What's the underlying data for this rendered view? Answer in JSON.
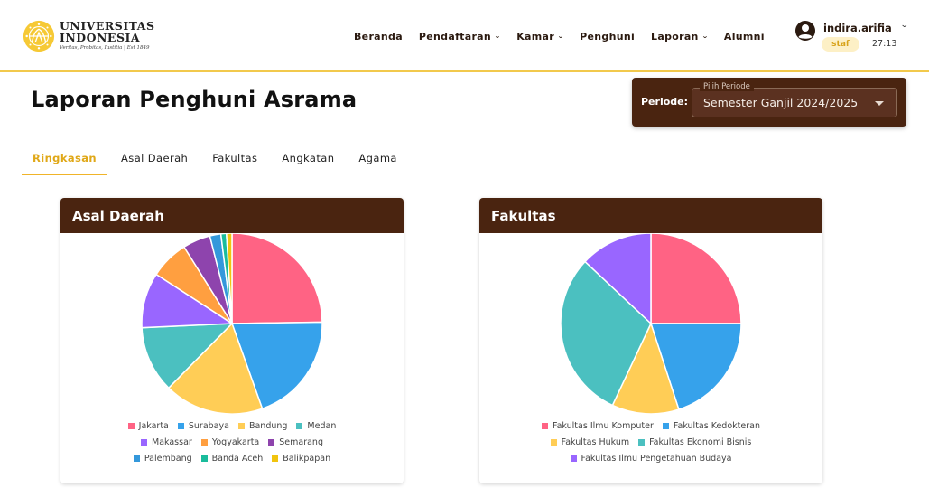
{
  "header": {
    "logo": {
      "line1": "UNIVERSITAS",
      "line2": "INDONESIA",
      "tagline": "Veritas, Probitas, Iustitia | Est 1849"
    },
    "nav": [
      {
        "label": "Beranda",
        "dropdown": false
      },
      {
        "label": "Pendaftaran",
        "dropdown": true
      },
      {
        "label": "Kamar",
        "dropdown": true
      },
      {
        "label": "Penghuni",
        "dropdown": false
      },
      {
        "label": "Laporan",
        "dropdown": true
      },
      {
        "label": "Alumni",
        "dropdown": false
      }
    ],
    "user": {
      "name": "indira.arifia",
      "role": "staf",
      "time": "27:13",
      "icon": "account-circle-icon"
    }
  },
  "page": {
    "title": "Laporan Penghuni Asrama",
    "period": {
      "label": "Periode:",
      "field_label": "Pilih Periode",
      "value": "Semester Ganjil 2024/2025"
    },
    "tabs": [
      "Ringkasan",
      "Asal Daerah",
      "Fakultas",
      "Angkatan",
      "Agama"
    ],
    "active_tab": "Ringkasan"
  },
  "colors": {
    "brown": "#4a2410",
    "accent": "#f2c94c"
  },
  "chart_data": [
    {
      "type": "pie",
      "title": "Asal Daerah",
      "categories": [
        "Jakarta",
        "Surabaya",
        "Bandung",
        "Medan",
        "Makassar",
        "Yogyakarta",
        "Semarang",
        "Palembang",
        "Banda Aceh",
        "Balikpapan"
      ],
      "values": [
        25,
        20,
        18,
        12,
        10,
        7,
        5,
        2,
        1,
        1
      ],
      "colors": [
        "#ff6384",
        "#36a2eb",
        "#ffcd56",
        "#4bc0c0",
        "#9966ff",
        "#ff9f40",
        "#8e44ad",
        "#3498db",
        "#1abc9c",
        "#f1c40f"
      ],
      "legend_rows": [
        [
          0,
          1,
          2,
          3
        ],
        [
          4,
          5,
          6
        ],
        [
          7,
          8,
          9
        ]
      ]
    },
    {
      "type": "pie",
      "title": "Fakultas",
      "categories": [
        "Fakultas Ilmu Komputer",
        "Fakultas Kedokteran",
        "Fakultas Hukum",
        "Fakultas Ekonomi Bisnis",
        "Fakultas Ilmu Pengetahuan Budaya"
      ],
      "values": [
        25,
        20,
        12,
        30,
        13
      ],
      "colors": [
        "#ff6384",
        "#36a2eb",
        "#ffcd56",
        "#4bc0c0",
        "#9966ff"
      ],
      "legend_rows": [
        [
          0,
          1
        ],
        [
          2,
          3
        ],
        [
          4
        ]
      ]
    }
  ]
}
